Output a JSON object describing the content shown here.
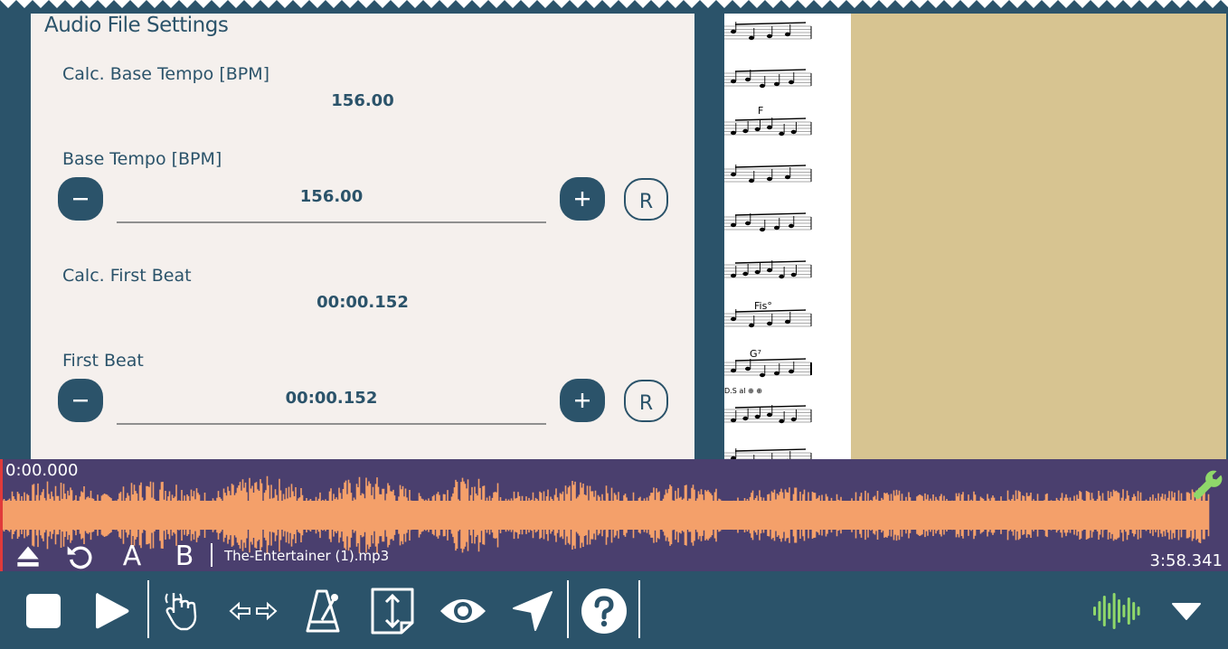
{
  "panel": {
    "title": "Audio File Settings",
    "calc_base_tempo": {
      "label": "Calc. Base Tempo [BPM]",
      "value": "156.00"
    },
    "base_tempo": {
      "label": "Base Tempo [BPM]",
      "value": "156.00",
      "reset_label": "R"
    },
    "calc_first_beat": {
      "label": "Calc. First Beat",
      "value": "00:00.152"
    },
    "first_beat": {
      "label": "First Beat",
      "value": "00:00.152",
      "reset_label": "R"
    }
  },
  "sheet": {
    "chords": [
      "F",
      "Fis°",
      "G⁷"
    ],
    "ds_text": "D.S al"
  },
  "player": {
    "time_current": "0:00.000",
    "time_total": "3:58.341",
    "filename": "The-Entertainer (1).mp3",
    "marker_a": "A",
    "marker_b": "B"
  },
  "colors": {
    "primary": "#2b536a",
    "panel_bg": "#f5f0ed",
    "waveform_bg": "#4a3f6e",
    "waveform": "#f4a06a",
    "tan": "#d7c491",
    "accent_green": "#8fd86a",
    "cursor": "#e03a3a"
  },
  "toolbar": {
    "icons": [
      "stop-icon",
      "play-icon",
      "hand-pointer-icon",
      "left-right-arrows-icon",
      "metronome-icon",
      "page-resize-icon",
      "eye-icon",
      "navigation-arrow-icon",
      "help-icon",
      "waveform-icon",
      "dropdown-arrow-icon"
    ]
  }
}
